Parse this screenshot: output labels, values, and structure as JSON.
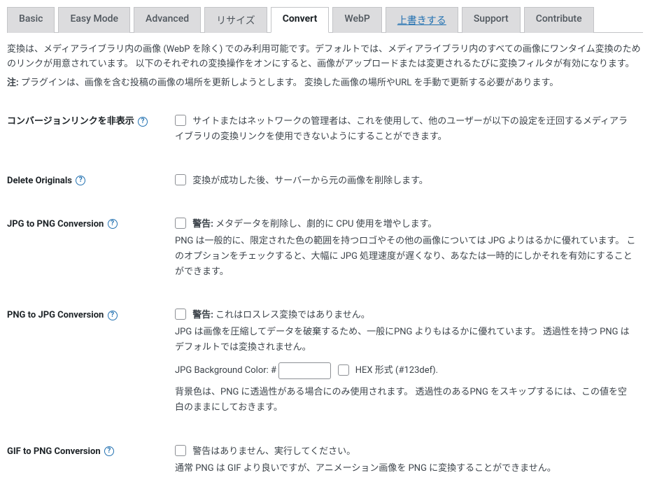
{
  "tabs": {
    "basic": "Basic",
    "easy": "Easy Mode",
    "advanced": "Advanced",
    "resize": "リサイズ",
    "convert": "Convert",
    "webp": "WebP",
    "overwrite": "上書きする",
    "support": "Support",
    "contribute": "Contribute"
  },
  "intro": {
    "p1": "変換は、メディアライブラリ内の画像 (WebP を除く) でのみ利用可能です。デフォルトでは、メディアライブラリ内のすべての画像にワンタイム変換のためのリンクが用意されています。 以下のそれぞれの変換操作をオンにすると、画像がアップロードまたは変更されるたびに変換フィルタが有効になります。",
    "note_label": "注:",
    "p2": " プラグインは、画像を含む投稿の画像の場所を更新しようとします。 変換した画像の場所やURL を手動で更新する必要があります。"
  },
  "rows": {
    "hide_links": {
      "label": "コンバージョンリンクを非表示",
      "text": "サイトまたはネットワークの管理者は、これを使用して、他のユーザーが以下の設定を迂回するメディアライブラリの変換リンクを使用できないようにすることができます。"
    },
    "delete_originals": {
      "label": "Delete Originals",
      "text": "変換が成功した後、サーバーから元の画像を削除します。"
    },
    "jpg2png": {
      "label": "JPG to PNG Conversion",
      "warn_prefix": "警告:",
      "warn_text": " メタデータを削除し、劇的に CPU 使用を増やします。",
      "desc": "PNG は一般的に、限定された色の範囲を持つロゴやその他の画像については JPG よりはるかに優れています。 このオプションをチェックすると、大幅に JPG 処理速度が遅くなり、あなたは一時的にしかそれを有効にすることができます。"
    },
    "png2jpg": {
      "label": "PNG to JPG Conversion",
      "warn_prefix": "警告:",
      "warn_text": " これはロスレス変換ではありません。",
      "desc1": "JPG は画像を圧縮してデータを破棄するため、一般にPNG よりもはるかに優れています。 透過性を持つ PNG はデフォルトでは変換されません。",
      "bg_label": "JPG Background Color: #",
      "bg_value": "",
      "hex_label": " HEX 形式 (#123def).",
      "desc2": "背景色は、PNG に透過性がある場合にのみ使用されます。 透過性のあるPNG をスキップするには、この値を空白のままにしておきます。"
    },
    "gif2png": {
      "label": "GIF to PNG Conversion",
      "text": "警告はありません、実行してください。",
      "desc": "通常 PNG は GIF より良いですが、アニメーション画像を PNG に変換することができません。"
    }
  }
}
